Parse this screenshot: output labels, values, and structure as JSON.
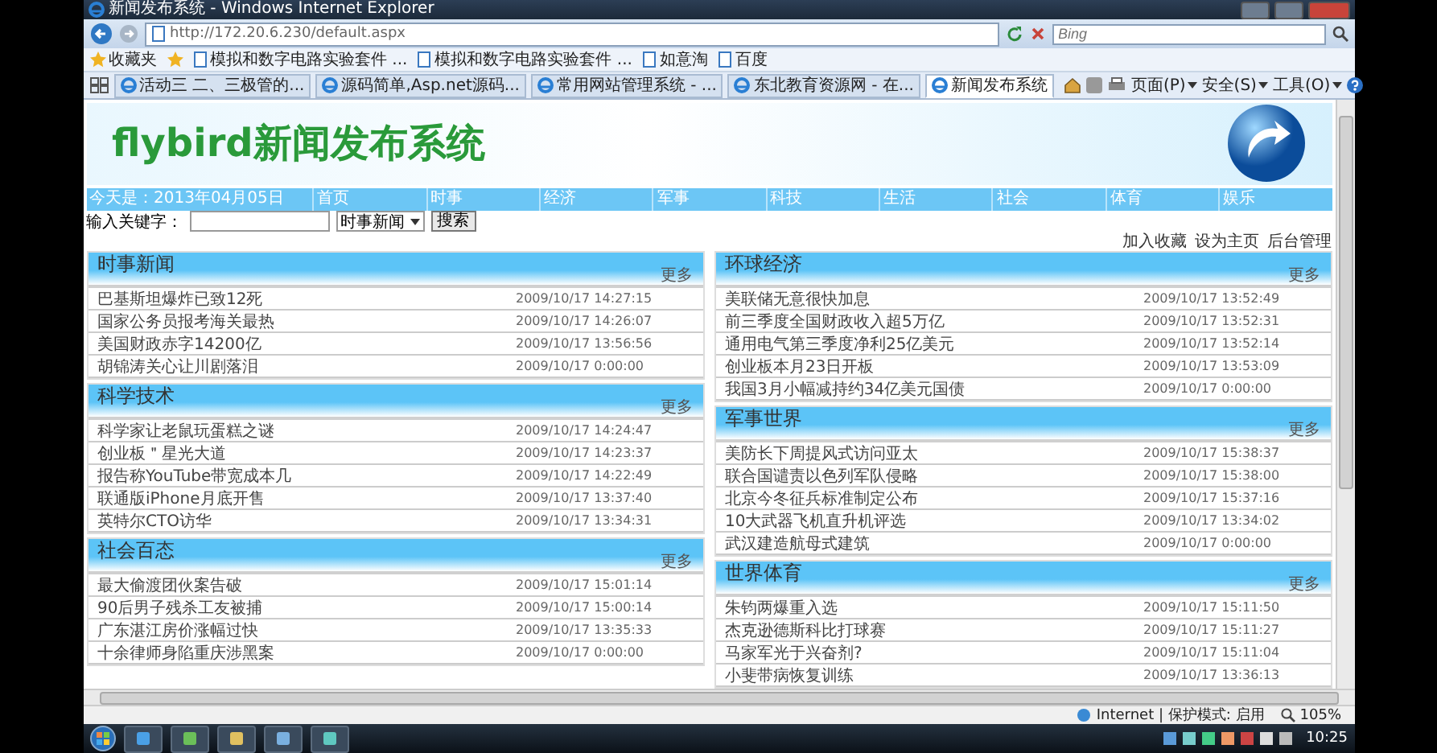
{
  "window": {
    "title": "新闻发布系统 - Windows Internet Explorer"
  },
  "address_bar": {
    "url": "http://172.20.6.230/default.aspx"
  },
  "search": {
    "placeholder": "Bing"
  },
  "favorites_bar": {
    "label": "收藏夹",
    "items": [
      "模拟和数字电路实验套件 ...",
      "模拟和数字电路实验套件 ...",
      "如意淘",
      "百度"
    ]
  },
  "tabs": [
    {
      "label": "活动三 二、三极管的...",
      "selected": false
    },
    {
      "label": "源码简单,Asp.net源码...",
      "selected": false
    },
    {
      "label": "常用网站管理系统 - ...",
      "selected": false
    },
    {
      "label": "东北教育资源网 - 在...",
      "selected": false
    },
    {
      "label": "新闻发布系统",
      "selected": true
    }
  ],
  "command_bar": [
    "页面(P)",
    "安全(S)",
    "工具(O)"
  ],
  "page": {
    "logo": "flybird新闻发布系统",
    "date": "今天是：2013年04月05日",
    "nav": [
      "首页",
      "时事",
      "经济",
      "军事",
      "科技",
      "生活",
      "社会",
      "体育",
      "娱乐"
    ],
    "search": {
      "label": "输入关键字：",
      "category": "时事新闻",
      "button": "搜索"
    },
    "links": [
      "加入收藏",
      "设为主页",
      "后台管理"
    ],
    "columns": [
      [
        {
          "title": "时事新闻",
          "more": "更多",
          "items": [
            {
              "title": "巴基斯坦爆炸已致12死",
              "time": "2009/10/17 14:27:15"
            },
            {
              "title": "国家公务员报考海关最热",
              "time": "2009/10/17 14:26:07"
            },
            {
              "title": "美国财政赤字14200亿",
              "time": "2009/10/17 13:56:56"
            },
            {
              "title": "胡锦涛关心让川剧落泪",
              "time": "2009/10/17 0:00:00"
            }
          ]
        },
        {
          "title": "科学技术",
          "more": "更多",
          "items": [
            {
              "title": "科学家让老鼠玩蛋糕之谜",
              "time": "2009/10/17 14:24:47"
            },
            {
              "title": "创业板＂星光大道",
              "time": "2009/10/17 14:23:37"
            },
            {
              "title": "报告称YouTube带宽成本几",
              "time": "2009/10/17 14:22:49"
            },
            {
              "title": "联通版iPhone月底开售",
              "time": "2009/10/17 13:37:40"
            },
            {
              "title": "英特尔CTO访华",
              "time": "2009/10/17 13:34:31"
            }
          ]
        },
        {
          "title": "社会百态",
          "more": "更多",
          "items": [
            {
              "title": "最大偷渡团伙案告破",
              "time": "2009/10/17 15:01:14"
            },
            {
              "title": "90后男子残杀工友被捕",
              "time": "2009/10/17 15:00:14"
            },
            {
              "title": "广东湛江房价涨幅过快",
              "time": "2009/10/17 13:35:33"
            },
            {
              "title": "十余律师身陷重庆涉黑案",
              "time": "2009/10/17 0:00:00"
            }
          ]
        }
      ],
      [
        {
          "title": "环球经济",
          "more": "更多",
          "items": [
            {
              "title": "美联储无意很快加息",
              "time": "2009/10/17 13:52:49"
            },
            {
              "title": "前三季度全国财政收入超5万亿",
              "time": "2009/10/17 13:52:31"
            },
            {
              "title": "通用电气第三季度净利25亿美元",
              "time": "2009/10/17 13:52:14"
            },
            {
              "title": "创业板本月23日开板",
              "time": "2009/10/17 13:53:09"
            },
            {
              "title": "我国3月小幅减持约34亿美元国债",
              "time": "2009/10/17 0:00:00"
            }
          ]
        },
        {
          "title": "军事世界",
          "more": "更多",
          "items": [
            {
              "title": "美防长下周提风式访问亚太",
              "time": "2009/10/17 15:38:37"
            },
            {
              "title": "联合国谴责以色列军队侵略",
              "time": "2009/10/17 15:38:00"
            },
            {
              "title": "北京今冬征兵标准制定公布",
              "time": "2009/10/17 15:37:16"
            },
            {
              "title": "10大武器飞机直升机评选",
              "time": "2009/10/17 13:34:02"
            },
            {
              "title": "武汉建造航母式建筑",
              "time": "2009/10/17 0:00:00"
            }
          ]
        },
        {
          "title": "世界体育",
          "more": "更多",
          "items": [
            {
              "title": "朱钧两爆重入选",
              "time": "2009/10/17 15:11:50"
            },
            {
              "title": "杰克逊德斯科比打球赛",
              "time": "2009/10/17 15:11:27"
            },
            {
              "title": "马家军光于兴奋剂?",
              "time": "2009/10/17 15:11:04"
            },
            {
              "title": "小斐带病恢复训练",
              "time": "2009/10/17 13:36:13"
            }
          ]
        }
      ]
    ]
  },
  "status_bar": {
    "zone": "Internet | 保护模式: 启用",
    "zoom": "105%"
  },
  "taskbar": {
    "clock": "10:25"
  }
}
